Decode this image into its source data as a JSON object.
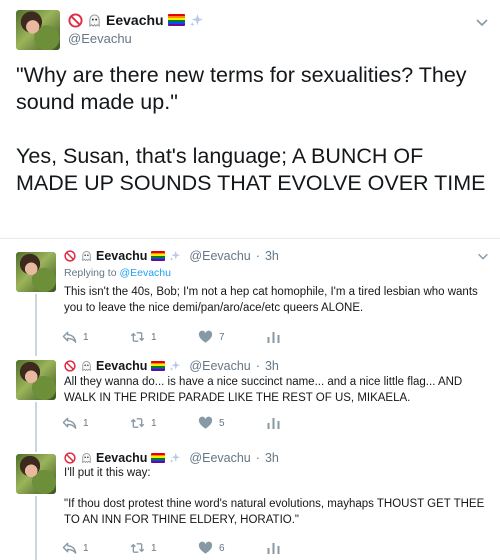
{
  "main_tweet": {
    "display_name": "Eevachu",
    "handle": "@Eevachu",
    "text": "\"Why are there new terms for sexualities? They sound made up.\"\n\nYes, Susan, that's language; A BUNCH OF MADE UP SOUNDS THAT EVOLVE OVER TIME",
    "emojis": [
      "no-entry-icon",
      "ghost-icon",
      "rainbow-flag-icon",
      "sparkles-icon"
    ]
  },
  "replies": [
    {
      "display_name": "Eevachu",
      "handle": "@Eevachu",
      "separator": "·",
      "time": "3h",
      "replying_prefix": "Replying to",
      "replying_handle": "@Eevachu",
      "text": "This isn't the 40s, Bob; I'm not a hep cat homophile, I'm a tired lesbian who wants you to leave the nice demi/pan/aro/ace/etc queers ALONE.",
      "reply_count": "1",
      "retweet_count": "1",
      "like_count": "7"
    },
    {
      "display_name": "Eevachu",
      "handle": "@Eevachu",
      "separator": "·",
      "time": "3h",
      "text": "All they wanna do... is have a nice succinct name... and a nice little flag... AND WALK IN THE PRIDE PARADE LIKE THE REST OF US, MIKAELA.",
      "reply_count": "1",
      "retweet_count": "1",
      "like_count": "5"
    },
    {
      "display_name": "Eevachu",
      "handle": "@Eevachu",
      "separator": "·",
      "time": "3h",
      "text": "I'll put it this way:\n\n\"If thou dost protest thine word's natural evolutions, mayhaps THOUST GET THEE TO AN INN FOR THINE ELDERY, HORATIO.\"",
      "reply_count": "1",
      "retweet_count": "1",
      "like_count": "6"
    }
  ],
  "colors": {
    "text": "#14171a",
    "secondary": "#657786",
    "link": "#1da1f2",
    "divider": "#e6ecf0",
    "thread_line": "#ccd6dd"
  }
}
